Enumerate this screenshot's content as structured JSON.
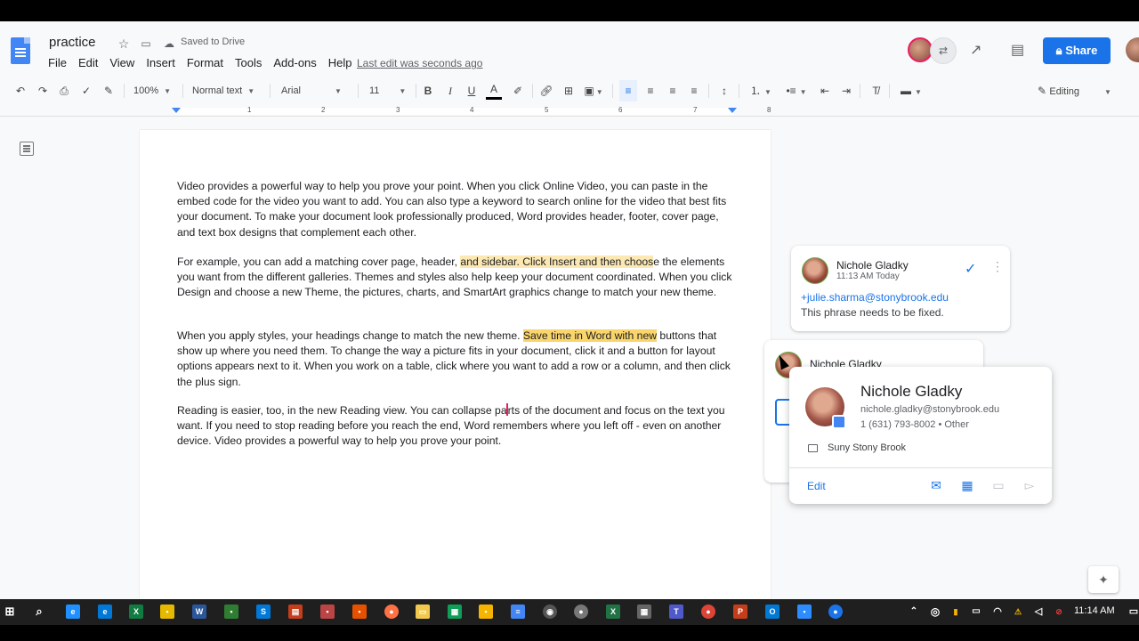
{
  "app": {
    "title": "practice",
    "saved_status": "Saved to Drive",
    "last_edit": "Last edit was seconds ago",
    "share_label": "Share",
    "menus": [
      "File",
      "Edit",
      "View",
      "Insert",
      "Format",
      "Tools",
      "Add-ons",
      "Help"
    ]
  },
  "toolbar": {
    "zoom": "100%",
    "style": "Normal text",
    "font": "Arial",
    "size": "11",
    "bold": "B",
    "italic": "I",
    "underline": "U",
    "text_color": "A",
    "mode": "Editing"
  },
  "ruler": {
    "numbers": [
      "1",
      "1",
      "2",
      "3",
      "4",
      "5",
      "6",
      "7",
      "8"
    ]
  },
  "document": {
    "p1": "Video provides a powerful way to help you prove your point. When you click Online Video, you can paste in the embed code for the video you want to add. You can also type a keyword to search online for the video that best fits your document. To make your document look professionally produced, Word provides header, footer, cover page, and text box designs that complement each other.",
    "p2_a": "For example, you can add a matching cover page, header, ",
    "p2_hl": "and sidebar. Click Insert and then choos",
    "p2_b": "e the elements you want from the different galleries. Themes and styles also help keep your document coordinated. When you click Design and choose a new Theme, the pictures, charts, and SmartArt graphics change to match your new theme.",
    "p3_a": "When you apply styles, your headings change to match the new theme. ",
    "p3_hl": "Save time in Word with new",
    "p3_b": " buttons that show up where you need them. To change the way a picture fits in your document, click it and a button for layout options appears next to it. When you work on a table, click where you want to add a row or a column, and then click the plus sign.",
    "p4_a": "Reading is easier, too, in the new Reading view. You can collapse pa",
    "p4_b": "rts of the document and focus on the text you want. If you need to stop reading before you reach the end, Word remembers where you left off - even on another device. Video provides a powerful way to help you prove your point."
  },
  "comment": {
    "author": "Nichole Gladky",
    "time": "11:13 AM Today",
    "mention": "+julie.sharma@stonybrook.edu",
    "body": "This phrase needs to be fixed."
  },
  "comment2": {
    "author": "Nichole Gladky"
  },
  "hover_card": {
    "name": "Nichole Gladky",
    "email": "nichole.gladky@stonybrook.edu",
    "phone": "1 (631) 793-8002 • Other",
    "org": "Suny Stony Brook",
    "edit_label": "Edit"
  },
  "taskbar": {
    "time": "11:14 AM"
  },
  "colors": {
    "accent": "#1a73e8",
    "highlight": "#fce8b2",
    "highlight_strong": "#f9d56c",
    "docs_blue": "#4285f4"
  }
}
